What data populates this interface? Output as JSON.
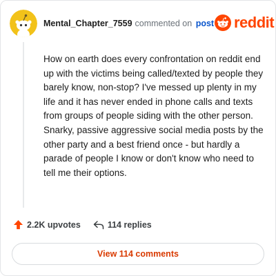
{
  "comment": {
    "username": "Mental_Chapter_7559",
    "meta_text": "commented on",
    "post_link": "post",
    "body": "How on earth does every confrontation on reddit end up with the victims being called/texted by people they barely know, non-stop? I've messed up plenty in my life and it has never ended in phone calls and texts from groups of people siding with the other person. Snarky, passive aggressive social media posts by the other party and a best friend once - but hardly a parade of people I know or don't know who need to tell me their options."
  },
  "brand": {
    "logo_text": "reddit",
    "color": "#ff4500"
  },
  "actions": {
    "upvotes": "2.2K upvotes",
    "replies": "114 replies",
    "upvote_icon": "upvote-arrow-icon",
    "reply_icon": "reply-arrow-icon"
  },
  "view_button": {
    "label": "View 114 comments"
  },
  "colors": {
    "username": "#1c1c1c",
    "link": "#0a55cc",
    "upvote": "#ff4500",
    "view_button_text": "#d93a00",
    "avatar_bg": "#f2c21a"
  }
}
